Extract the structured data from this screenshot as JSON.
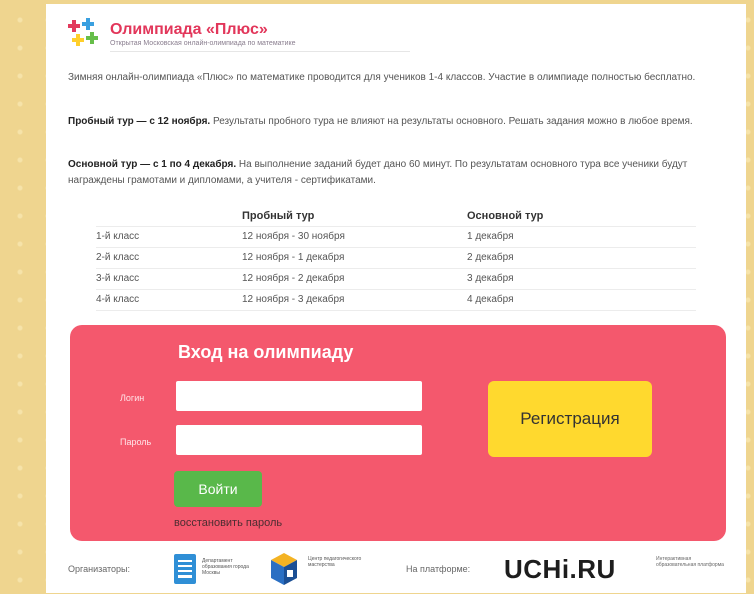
{
  "header": {
    "title": "Олимпиада «Плюс»",
    "subtitle": "Открытая Московская онлайн-олимпиада по математике"
  },
  "intro": {
    "p1": "Зимняя онлайн-олимпиада «Плюс» по математике проводится для учеников 1-4 классов. Участие в олимпиаде полностью бесплатно.",
    "p2_bold": "Пробный тур — с 12 ноября.",
    "p2_text": " Результаты пробного тура не влияют на результаты основного. Решать задания можно в любое время.",
    "p3_bold": "Основной тур — с 1 по 4 декабря.",
    "p3_text": " На выполнение заданий будет дано 60 минут. По результатам основного тура все ученики будут награждены грамотами и дипломами, а учителя - сертификатами."
  },
  "schedule": {
    "headers": [
      "",
      "Пробный тур",
      "Основной тур"
    ],
    "rows": [
      [
        "1-й класс",
        "12 ноября - 30 ноября",
        "1 декабря"
      ],
      [
        "2-й класс",
        "12 ноября - 1 декабря",
        "2 декабря"
      ],
      [
        "3-й класс",
        "12 ноября - 2 декабря",
        "3 декабря"
      ],
      [
        "4-й класс",
        "12 ноября - 3 декабря",
        "4 декабря"
      ]
    ]
  },
  "login": {
    "title": "Вход на олимпиаду",
    "login_label": "Логин",
    "login_value": "",
    "password_label": "Пароль",
    "password_value": "",
    "submit_label": "Войти",
    "restore_label": "восстановить пароль",
    "register_label": "Регистрация"
  },
  "footer": {
    "organizers_label": "Организаторы:",
    "org1_text": "Департамент образования города Москвы",
    "org2_text": "Центр педагогического мастерства",
    "platform_label": "На платформе:",
    "platform_name": "UCHi.RU",
    "platform_note": "Интерактивная образовательная платформа"
  },
  "colors": {
    "panel": "#f4586d",
    "button_green": "#59b84a",
    "button_yellow": "#ffd92e",
    "title_pink": "#e2365a",
    "plus_icons": [
      "#e23a5c",
      "#ffcf2b",
      "#3aa0e0",
      "#66be4a"
    ]
  },
  "icons": {
    "logo": "colored-plus-signs-icon",
    "org1": "department-education-icon",
    "org2": "cube-icon"
  }
}
